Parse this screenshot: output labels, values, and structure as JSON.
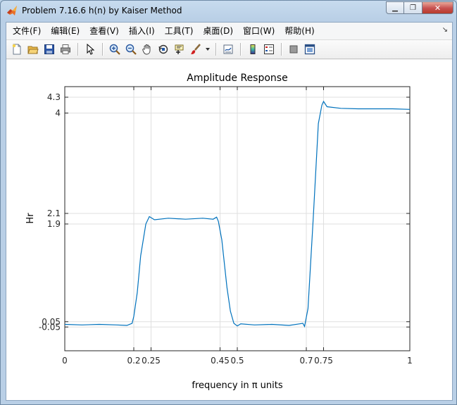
{
  "window": {
    "title": "Problem 7.16.6 h(n) by Kaiser Method",
    "controls": {
      "minimize": "▁",
      "restore": "❐",
      "close": "✕"
    }
  },
  "menu": {
    "items": [
      "文件(F)",
      "编辑(E)",
      "查看(V)",
      "插入(I)",
      "工具(T)",
      "桌面(D)",
      "窗口(W)",
      "帮助(H)"
    ],
    "dock_glyph": "↘"
  },
  "toolbar": {
    "icons": [
      "new-figure-icon",
      "open-file-icon",
      "save-icon",
      "print-icon",
      "pointer-icon",
      "zoom-in-icon",
      "zoom-out-icon",
      "pan-icon",
      "rotate-3d-icon",
      "data-cursor-icon",
      "brush-icon",
      "link-plot-icon",
      "colorbar-icon",
      "legend-icon",
      "hide-plot-tools-icon",
      "show-plot-tools-icon"
    ]
  },
  "chart_data": {
    "type": "line",
    "title": "Amplitude Response",
    "xlabel": "frequency in π units",
    "ylabel": "Hr",
    "xlim": [
      0,
      1
    ],
    "ylim": [
      -0.5,
      4.5
    ],
    "xticks": [
      0,
      0.2,
      0.25,
      0.45,
      0.5,
      0.7,
      0.75,
      1
    ],
    "xtick_labels": [
      "0",
      "0.2",
      "0.25",
      "0.45",
      "0.5",
      "0.7",
      "0.75",
      "1"
    ],
    "yticks": [
      -0.05,
      0.05,
      1.9,
      2.1,
      4,
      4.3
    ],
    "ytick_labels": [
      "-0.05",
      "0.05",
      "1.9",
      "2.1",
      "4",
      "4.3"
    ],
    "grid": true,
    "line_color": "#0072bd",
    "series": [
      {
        "x": [
          0,
          0.05,
          0.1,
          0.15,
          0.18,
          0.195,
          0.2,
          0.21,
          0.22,
          0.235,
          0.245,
          0.25,
          0.26,
          0.3,
          0.35,
          0.4,
          0.43,
          0.44,
          0.445,
          0.455,
          0.47,
          0.48,
          0.49,
          0.5,
          0.51,
          0.55,
          0.6,
          0.65,
          0.68,
          0.69,
          0.695,
          0.705,
          0.72,
          0.735,
          0.745,
          0.75,
          0.76,
          0.8,
          0.85,
          0.9,
          0.95,
          1
        ],
        "y": [
          0.0,
          -0.01,
          0.0,
          -0.01,
          -0.02,
          0.02,
          0.15,
          0.6,
          1.3,
          1.9,
          2.04,
          2.02,
          1.98,
          2.01,
          1.99,
          2.01,
          1.99,
          2.03,
          1.95,
          1.6,
          0.7,
          0.25,
          0.02,
          -0.03,
          0.01,
          -0.01,
          0.0,
          -0.02,
          0.01,
          0.02,
          -0.04,
          0.3,
          2.0,
          3.8,
          4.15,
          4.22,
          4.12,
          4.09,
          4.08,
          4.08,
          4.08,
          4.07
        ]
      }
    ]
  }
}
